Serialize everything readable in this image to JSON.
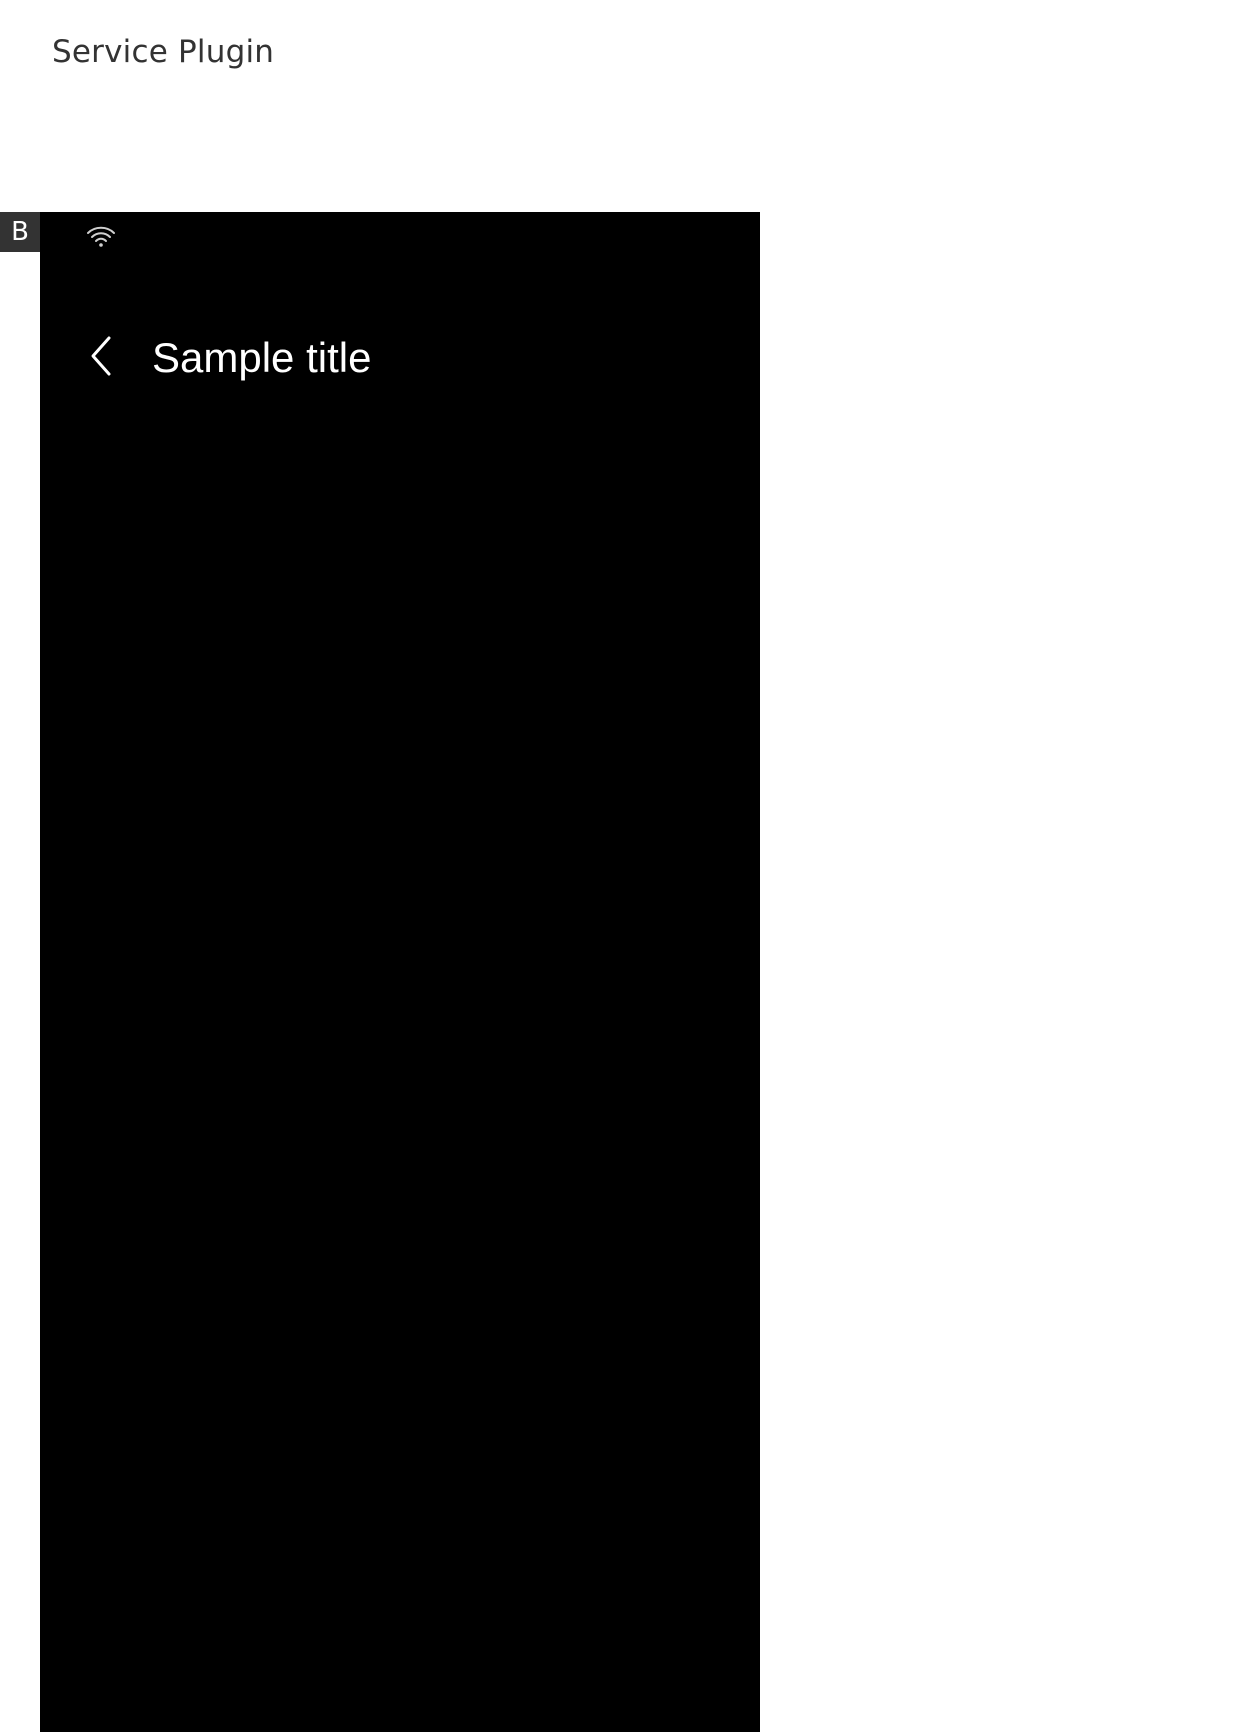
{
  "document": {
    "title": "Service Plugin",
    "badge_label": "B"
  },
  "status_bar": {
    "wifi_icon": "wifi-icon"
  },
  "header": {
    "back_icon": "chevron-left-icon",
    "title": "Sample title"
  },
  "colors": {
    "page_background": "#ffffff",
    "document_title": "#333333",
    "badge_background": "#333333",
    "screen_background": "#000000",
    "screen_text": "#ffffff"
  }
}
